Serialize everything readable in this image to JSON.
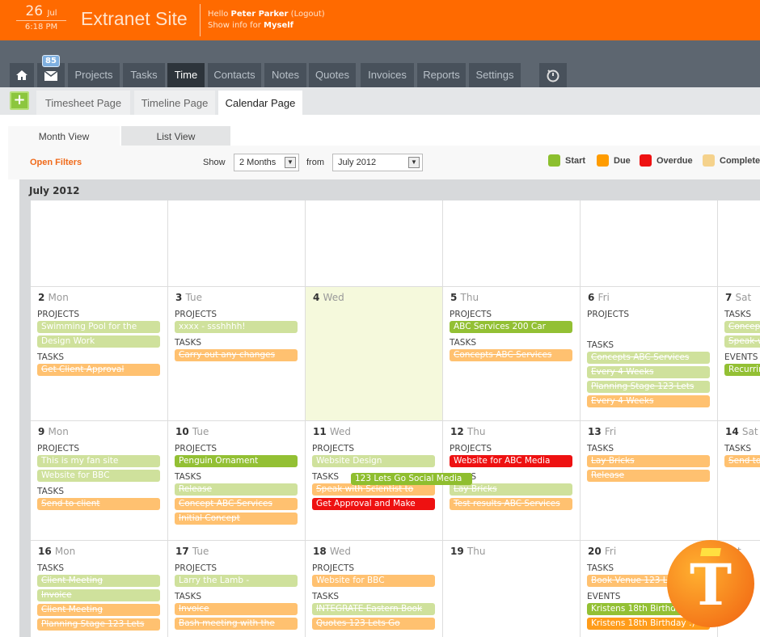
{
  "header": {
    "day": "26",
    "month": "Jul",
    "time": "6:18 PM",
    "site_title": "Extranet Site",
    "hello": "Hello",
    "user": "Peter Parker",
    "logout": "(Logout)",
    "show_info": "Show info for",
    "show_for": "Myself"
  },
  "nav": {
    "badge": "85",
    "tabs": [
      "Projects",
      "Tasks",
      "Time",
      "Contacts",
      "Notes",
      "Quotes",
      "Invoices",
      "Reports",
      "Settings"
    ],
    "active": "Time"
  },
  "subnav": {
    "tabs": [
      "Timesheet Page",
      "Timeline Page",
      "Calendar Page"
    ],
    "active": "Calendar Page"
  },
  "views": {
    "month": "Month View",
    "list": "List View"
  },
  "toolbar": {
    "open_filters": "Open Filters",
    "show_label": "Show",
    "show_value": "2 Months",
    "from_label": "from",
    "from_value": "July 2012"
  },
  "legend": [
    {
      "label": "Start",
      "color": "#8cbf2e"
    },
    {
      "label": "Due",
      "color": "#ff9c00"
    },
    {
      "label": "Overdue",
      "color": "#ee1111"
    },
    {
      "label": "Complete",
      "color": "#f5d28c"
    }
  ],
  "colors": {
    "start": "#93c034",
    "start_done": "#cfe19c",
    "due": "#ffc170",
    "overdue": "#ee1111",
    "event_due": "#ff9c1a"
  },
  "calendar": {
    "title": "July 2012",
    "spanning_event": "123 Lets Go Social Media",
    "weeks": [
      [
        {},
        {},
        {},
        {},
        {},
        {}
      ],
      [
        {
          "num": "2",
          "day": "Mon",
          "sections": [
            {
              "label": "PROJECTS",
              "items": [
                {
                  "t": "Swimming Pool for the",
                  "c": "start_done"
                },
                {
                  "t": "Design Work",
                  "c": "start_done"
                }
              ]
            },
            {
              "label": "TASKS",
              "items": [
                {
                  "t": "Get Client Approval",
                  "c": "due",
                  "s": true
                }
              ]
            }
          ]
        },
        {
          "num": "3",
          "day": "Tue",
          "sections": [
            {
              "label": "PROJECTS",
              "items": [
                {
                  "t": "xxxx - ssshhhh!",
                  "c": "start_done"
                }
              ]
            },
            {
              "label": "TASKS",
              "items": [
                {
                  "t": "Carry out any changes",
                  "c": "due",
                  "s": true
                }
              ]
            }
          ]
        },
        {
          "num": "4",
          "day": "Wed",
          "today": true,
          "sections": []
        },
        {
          "num": "5",
          "day": "Thu",
          "sections": [
            {
              "label": "PROJECTS",
              "items": [
                {
                  "t": "ABC Services 200 Car",
                  "c": "start"
                }
              ]
            },
            {
              "label": "TASKS",
              "items": [
                {
                  "t": "Concepts ABC Services",
                  "c": "due",
                  "s": true
                }
              ]
            }
          ]
        },
        {
          "num": "6",
          "day": "Fri",
          "sections": [
            {
              "label": "PROJECTS",
              "items": []
            },
            {
              "label": "TASKS",
              "items": [
                {
                  "t": "Concepts ABC Services",
                  "c": "start_done",
                  "s": true
                },
                {
                  "t": "Every 4 Weeks",
                  "c": "start_done",
                  "s": true
                },
                {
                  "t": "Planning Stage 123 Lets",
                  "c": "start_done",
                  "s": true
                },
                {
                  "t": "Every 4 Weeks",
                  "c": "due",
                  "s": true
                }
              ]
            }
          ]
        },
        {
          "num": "7",
          "day": "Sat",
          "sections": [
            {
              "label": "TASKS",
              "items": [
                {
                  "t": "Concept",
                  "c": "start_done",
                  "s": true
                },
                {
                  "t": "Speak-w",
                  "c": "start_done",
                  "s": true
                }
              ]
            },
            {
              "label": "EVENTS",
              "items": [
                {
                  "t": "Recurrin",
                  "c": "start"
                }
              ]
            }
          ]
        }
      ],
      [
        {
          "num": "9",
          "day": "Mon",
          "sections": [
            {
              "label": "PROJECTS",
              "items": [
                {
                  "t": "This is my fan site",
                  "c": "start_done"
                },
                {
                  "t": "Website for BBC",
                  "c": "start_done"
                }
              ]
            },
            {
              "label": "TASKS",
              "items": [
                {
                  "t": "Send to client",
                  "c": "due",
                  "s": true
                }
              ]
            }
          ]
        },
        {
          "num": "10",
          "day": "Tue",
          "sections": [
            {
              "label": "PROJECTS",
              "items": [
                {
                  "t": "Penguin Ornament",
                  "c": "start"
                }
              ]
            },
            {
              "label": "TASKS",
              "items": [
                {
                  "t": "Release",
                  "c": "start_done",
                  "s": true
                },
                {
                  "t": "Concept ABC Services",
                  "c": "due",
                  "s": true
                },
                {
                  "t": "Initial Concept",
                  "c": "due",
                  "s": true
                }
              ]
            }
          ]
        },
        {
          "num": "11",
          "day": "Wed",
          "sections": [
            {
              "label": "PROJECTS",
              "items": [
                {
                  "t": "Website Design",
                  "c": "start_done"
                }
              ]
            },
            {
              "label": "TASKS",
              "items": [
                {
                  "t": "Speak with Scientist to",
                  "c": "due",
                  "s": true
                },
                {
                  "t": "Get Approval and Make",
                  "c": "overdue"
                }
              ]
            }
          ]
        },
        {
          "num": "12",
          "day": "Thu",
          "sections": [
            {
              "label": "PROJECTS",
              "items": [
                {
                  "t": "Website for ABC Media",
                  "c": "overdue"
                }
              ]
            },
            {
              "label": "TASKS",
              "items": [
                {
                  "t": "Lay Bricks",
                  "c": "start_done",
                  "s": true
                },
                {
                  "t": "Test results ABC Services",
                  "c": "due",
                  "s": true
                }
              ]
            }
          ]
        },
        {
          "num": "13",
          "day": "Fri",
          "sections": [
            {
              "label": "TASKS",
              "items": [
                {
                  "t": "Lay Bricks",
                  "c": "due",
                  "s": true
                },
                {
                  "t": "Release",
                  "c": "due",
                  "s": true
                }
              ]
            }
          ]
        },
        {
          "num": "14",
          "day": "Sat",
          "sections": [
            {
              "label": "TASKS",
              "items": [
                {
                  "t": "Send to",
                  "c": "due",
                  "s": true
                }
              ]
            }
          ]
        }
      ],
      [
        {
          "num": "16",
          "day": "Mon",
          "sections": [
            {
              "label": "TASKS",
              "items": [
                {
                  "t": "Client Meeting",
                  "c": "start_done",
                  "s": true
                },
                {
                  "t": "Invoice",
                  "c": "start_done",
                  "s": true
                },
                {
                  "t": "Client Meeting",
                  "c": "due",
                  "s": true
                },
                {
                  "t": "Planning Stage 123 Lets",
                  "c": "due",
                  "s": true
                }
              ]
            }
          ]
        },
        {
          "num": "17",
          "day": "Tue",
          "sections": [
            {
              "label": "PROJECTS",
              "items": [
                {
                  "t": "Larry the Lamb -",
                  "c": "start_done"
                }
              ]
            },
            {
              "label": "TASKS",
              "items": [
                {
                  "t": "Invoice",
                  "c": "due",
                  "s": true
                },
                {
                  "t": "Bash meeting with the",
                  "c": "due",
                  "s": true
                }
              ]
            }
          ]
        },
        {
          "num": "18",
          "day": "Wed",
          "sections": [
            {
              "label": "PROJECTS",
              "items": [
                {
                  "t": "Website for BBC",
                  "c": "due"
                }
              ]
            },
            {
              "label": "TASKS",
              "items": [
                {
                  "t": "INTEGRATE Eastern Book",
                  "c": "start_done",
                  "s": true
                },
                {
                  "t": "Quotes 123 Lets Go",
                  "c": "due",
                  "s": true
                }
              ]
            }
          ]
        },
        {
          "num": "19",
          "day": "Thu",
          "sections": []
        },
        {
          "num": "20",
          "day": "Fri",
          "sections": [
            {
              "label": "TASKS",
              "items": [
                {
                  "t": "Book Venue 123 L",
                  "c": "due",
                  "s": true
                }
              ]
            },
            {
              "label": "EVENTS",
              "items": [
                {
                  "t": "Kristens 18th Birthday :)",
                  "c": "start"
                },
                {
                  "t": "Kristens 18th Birthday :)",
                  "c": "event_due"
                }
              ]
            }
          ]
        },
        {
          "num": "",
          "day": "Sat",
          "sections": []
        }
      ]
    ]
  }
}
